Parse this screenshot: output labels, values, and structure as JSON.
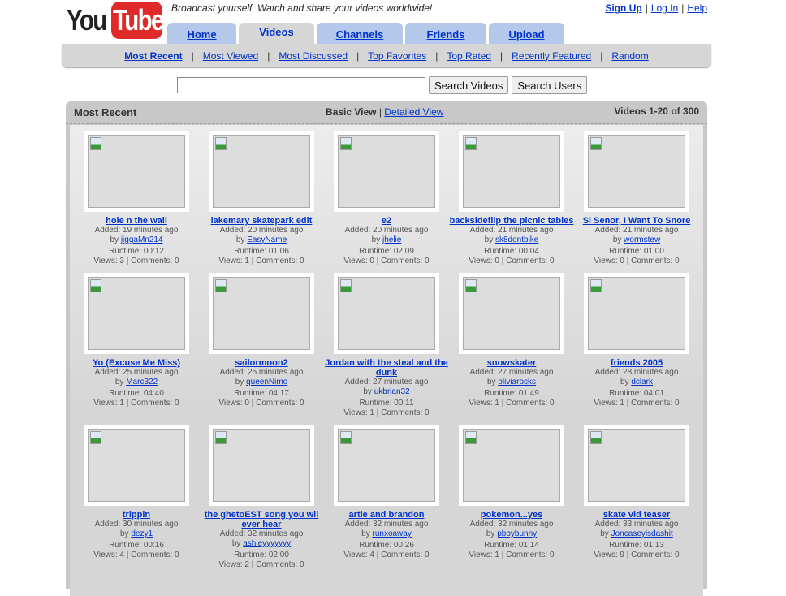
{
  "header": {
    "logo_you": "You",
    "logo_tube": "Tube",
    "tagline": "Broadcast yourself. Watch and share your videos worldwide!",
    "user_links": [
      "Sign Up",
      "Log In",
      "Help"
    ],
    "separator": "|"
  },
  "tabs": [
    {
      "label": "Home",
      "active": false
    },
    {
      "label": "Videos",
      "active": true
    },
    {
      "label": "Channels",
      "active": false
    },
    {
      "label": "Friends",
      "active": false
    },
    {
      "label": "Upload",
      "active": false
    }
  ],
  "subnav": [
    {
      "label": "Most Recent",
      "active": true
    },
    {
      "label": "Most Viewed"
    },
    {
      "label": "Most Discussed"
    },
    {
      "label": "Top Favorites"
    },
    {
      "label": "Top Rated"
    },
    {
      "label": "Recently Featured"
    },
    {
      "label": "Random"
    }
  ],
  "search": {
    "value": "",
    "placeholder": "",
    "search_videos_label": "Search Videos",
    "search_users_label": "Search Users"
  },
  "panel": {
    "title": "Most Recent",
    "basic_view": "Basic View",
    "view_sep": "|",
    "detailed_view": "Detailed View",
    "count": "Videos 1-20 of 300"
  },
  "videos": [
    {
      "title": "hole n the wall",
      "added": "Added: 19 minutes ago",
      "by": "by",
      "user": "jiggaMn214",
      "runtime": "Runtime: 00:12",
      "stats": "Views: 3 | Comments: 0"
    },
    {
      "title": "lakemary skatepark edit",
      "added": "Added: 20 minutes ago",
      "by": "by",
      "user": "EasyName",
      "runtime": "Runtime: 01:06",
      "stats": "Views: 1 | Comments: 0"
    },
    {
      "title": "e2",
      "added": "Added: 20 minutes ago",
      "by": "by",
      "user": "jhelie",
      "runtime": "Runtime: 02:09",
      "stats": "Views: 0 | Comments: 0"
    },
    {
      "title": "backsideflip the picnic tables",
      "added": "Added: 21 minutes ago",
      "by": "by",
      "user": "sk8dontbike",
      "runtime": "Runtime: 00:04",
      "stats": "Views: 0 | Comments: 0"
    },
    {
      "title": "Si Senor, I Want To Snore",
      "added": "Added: 21 minutes ago",
      "by": "by",
      "user": "wormstew",
      "runtime": "Runtime: 01:00",
      "stats": "Views: 0 | Comments: 0"
    },
    {
      "title": "Yo (Excuse Me Miss)",
      "added": "Added: 25 minutes ago",
      "by": "by",
      "user": "Marc322",
      "runtime": "Runtime: 04:40",
      "stats": "Views: 1 | Comments: 0"
    },
    {
      "title": "sailormoon2",
      "added": "Added: 25 minutes ago",
      "by": "by",
      "user": "queenNimo",
      "runtime": "Runtime: 04:17",
      "stats": "Views: 0 | Comments: 0"
    },
    {
      "title": "Jordan with the steal and the dunk",
      "added": "Added: 27 minutes ago",
      "by": "by",
      "user": "ukbrian32",
      "runtime": "Runtime: 00:11",
      "stats": "Views: 1 | Comments: 0"
    },
    {
      "title": "snowskater",
      "added": "Added: 27 minutes ago",
      "by": "by",
      "user": "oliviarocks",
      "runtime": "Runtime: 01:49",
      "stats": "Views: 1 | Comments: 0"
    },
    {
      "title": "friends 2005",
      "added": "Added: 28 minutes ago",
      "by": "by",
      "user": "dclark",
      "runtime": "Runtime: 04:01",
      "stats": "Views: 1 | Comments: 0"
    },
    {
      "title": "trippin",
      "added": "Added: 30 minutes ago",
      "by": "by",
      "user": "dezy1",
      "runtime": "Runtime: 00:16",
      "stats": "Views: 4 | Comments: 0"
    },
    {
      "title": "the ghetoEST song you wil ever hear",
      "added": "Added: 32 minutes ago",
      "by": "by",
      "user": "ashleyyyyyyy",
      "runtime": "Runtime: 02:00",
      "stats": "Views: 2 | Comments: 0"
    },
    {
      "title": "artie and brandon",
      "added": "Added: 32 minutes ago",
      "by": "by",
      "user": "runxoaway",
      "runtime": "Runtime: 00:26",
      "stats": "Views: 4 | Comments: 0"
    },
    {
      "title": "pokemon...yes",
      "added": "Added: 32 minutes ago",
      "by": "by",
      "user": "pboybunny",
      "runtime": "Runtime: 01:14",
      "stats": "Views: 1 | Comments: 0"
    },
    {
      "title": "skate vid teaser",
      "added": "Added: 33 minutes ago",
      "by": "by",
      "user": "Joncaseyisdashit",
      "runtime": "Runtime: 01:13",
      "stats": "Views: 9 | Comments: 0"
    }
  ]
}
